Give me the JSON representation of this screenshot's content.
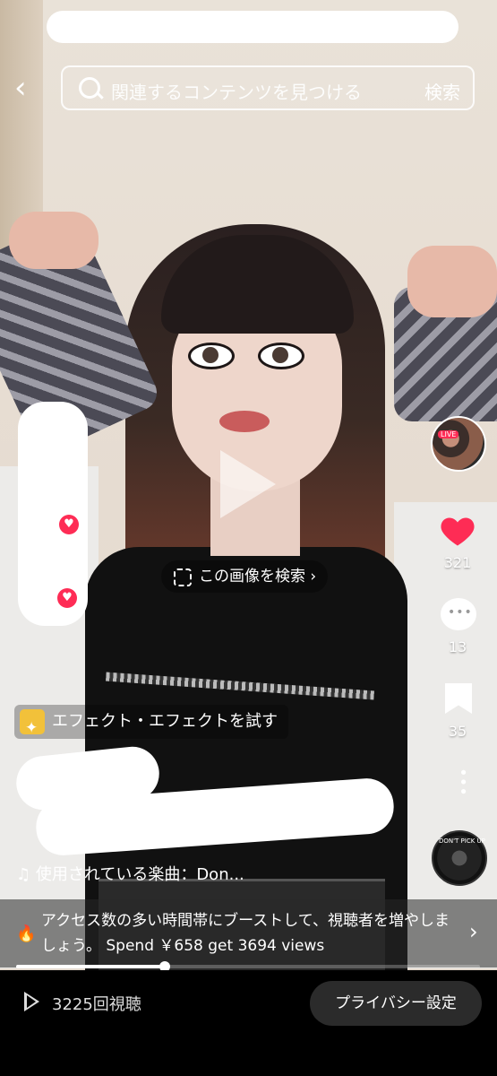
{
  "search": {
    "back_icon": "chevron-left-icon",
    "placeholder": "関連するコンテンツを見つける",
    "button_label": "検索"
  },
  "image_search": {
    "label": "この画像を検索 ›"
  },
  "rail": {
    "like_count": "321",
    "comment_count": "13",
    "bookmark_count": "35",
    "live_badge": "LIVE",
    "music_disc_text": "DON'T PICK UP"
  },
  "effect": {
    "label": "エフェクト・エフェクトを試す"
  },
  "caption": {
    "music_line": "♫ 使用されている楽曲：Don..."
  },
  "promo": {
    "text": "アクセス数の多い時間帯にブーストして、視聴者を増やしましょう。 Spend ￥658 get 3694 views",
    "chevron": "›"
  },
  "playback": {
    "progress": 0.32
  },
  "bottom": {
    "views": "3225回視聴",
    "privacy_button": "プライバシー設定"
  },
  "colors": {
    "accent": "#fe2c55",
    "effect_icon": "#f2c13a"
  }
}
